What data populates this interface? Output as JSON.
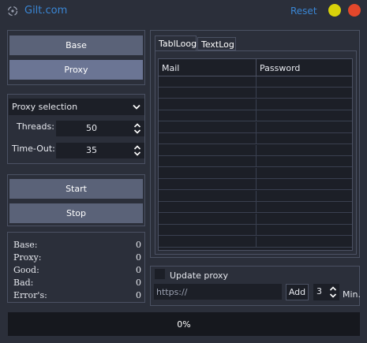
{
  "titlebar": {
    "title": "Gilt.com",
    "reset_label": "Reset",
    "icon": "sparkle-icon",
    "minimize_color": "#d8d20a",
    "close_color": "#e3472b",
    "accent": "#3a86d4"
  },
  "mode": {
    "base_label": "Base",
    "proxy_label": "Proxy",
    "selected": "Proxy"
  },
  "settings": {
    "proxy_select": "Proxy selection",
    "threads_label": "Threads:",
    "threads_value": "50",
    "timeout_label": "Time-Out:",
    "timeout_value": "35"
  },
  "actions": {
    "start_label": "Start",
    "stop_label": "Stop"
  },
  "stats": {
    "base_label": "Base:",
    "base_value": "0",
    "proxy_label": "Proxy:",
    "proxy_value": "0",
    "good_label": "Good:",
    "good_value": "0",
    "bad_label": "Bad:",
    "bad_value": "0",
    "errors_label": "Error's:",
    "errors_value": "0"
  },
  "log": {
    "tabs": [
      "TablLoog",
      "TextLog"
    ],
    "active_tab": "TablLoog",
    "columns": [
      "Mail",
      "Password"
    ],
    "rows": []
  },
  "proxy_update": {
    "checkbox_label": "Update proxy",
    "checked": false,
    "url_placeholder": "https://",
    "add_label": "Add",
    "interval_value": "3",
    "interval_unit": "Min."
  },
  "progress": {
    "value": 0,
    "text": "0%"
  }
}
